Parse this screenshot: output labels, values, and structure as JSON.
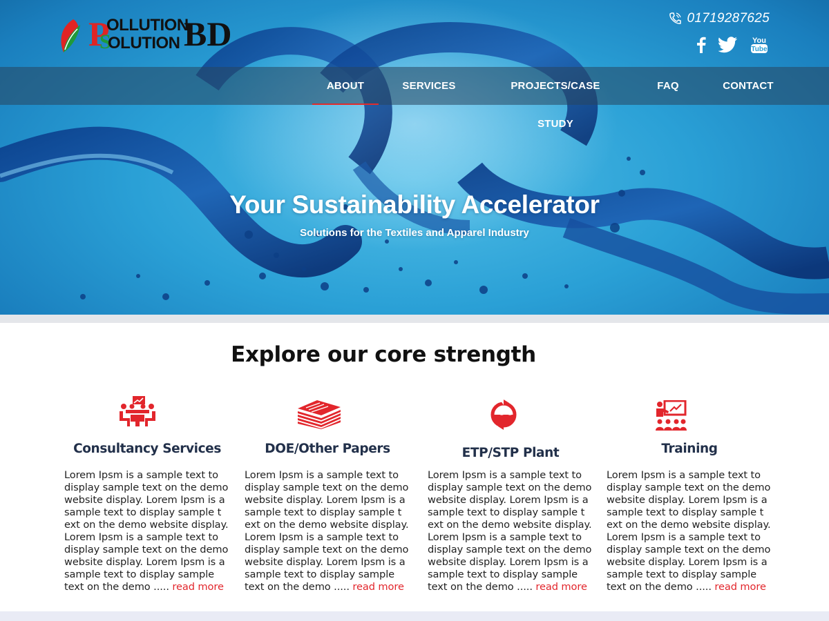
{
  "brand": {
    "logo_big_p": "P",
    "logo_big_s": "S",
    "logo_line1": "OLLUTION",
    "logo_line2": "OLUTION",
    "logo_bd": "BD",
    "colors": {
      "red": "#e02424",
      "green": "#1f9a3a",
      "dark": "#111111"
    }
  },
  "header": {
    "phone_icon": "phone-icon",
    "phone": "01719287625",
    "social": [
      {
        "icon": "facebook-icon"
      },
      {
        "icon": "twitter-icon"
      },
      {
        "icon": "youtube-icon",
        "line1": "You",
        "line2": "Tube"
      }
    ]
  },
  "nav": {
    "items": [
      {
        "label": "ABOUT",
        "active": true
      },
      {
        "label": "SERVICES",
        "active": false
      },
      {
        "label": "PROJECTS/CASE STUDY",
        "active": false
      },
      {
        "label": "FAQ",
        "active": false
      },
      {
        "label": "CONTACT",
        "active": false
      }
    ],
    "accent": "#e22b2b"
  },
  "hero": {
    "title": "Your Sustainability Accelerator",
    "subtitle": "Solutions for the Textiles and Apparel Industry"
  },
  "section": {
    "title": "Explore our core strength"
  },
  "cards": [
    {
      "icon": "consultancy-meeting-icon",
      "title": "Consultancy Services",
      "text": "Lorem Ipsm is a sample text to display sample text on the demo website display. Lorem Ipsm is a sample text to display sample t ext on the demo website display. Lorem Ipsm is a sample text to display sample text on the demo website display. Lorem Ipsm is a sample text to display sample text on the demo .....",
      "more": "read more"
    },
    {
      "icon": "papers-stack-icon",
      "title": "DOE/Other Papers",
      "text": "Lorem Ipsm is a sample text to display sample text on the demo website display. Lorem Ipsm is a sample text to display sample t ext on the demo website display. Lorem Ipsm is a sample text to display sample text on the demo website display. Lorem Ipsm is a sample text to display sample text on the demo  .....",
      "more": "read more"
    },
    {
      "icon": "water-cycle-icon",
      "title": "ETP/STP Plant",
      "text": "Lorem Ipsm is a sample text to display sample text on the demo website display. Lorem Ipsm is a sample text to display sample t ext on the demo website display. Lorem Ipsm is a sample text to display sample text on the demo website display. Lorem Ipsm is a sample text to display sample text on the demo .....",
      "more": "read more"
    },
    {
      "icon": "training-class-icon",
      "title": "Training",
      "text": "Lorem Ipsm is a sample text to display sample text on the demo website display. Lorem Ipsm is a sample text to display sample t ext on the demo website display. Lorem Ipsm is a sample text to display sample text on the demo website display. Lorem Ipsm is a sample text to display sample text on the demo .....",
      "more": "read more"
    }
  ],
  "accent_red": "#e2262c"
}
